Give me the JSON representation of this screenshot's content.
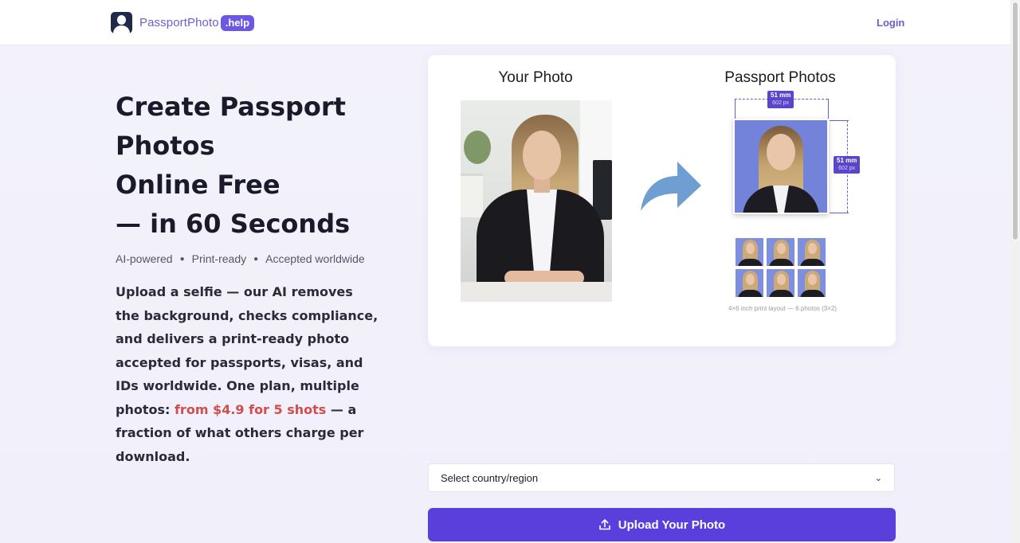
{
  "header": {
    "logo_text": "PassportPhoto",
    "logo_badge": ".help",
    "login_label": "Login"
  },
  "hero": {
    "title_lines": [
      "Create Passport",
      "Photos",
      "Online Free",
      "— in 60 Seconds"
    ],
    "tags": [
      "AI-powered",
      "Print-ready",
      "Accepted worldwide"
    ],
    "description_main": "Upload a selfie — our AI removes the background, checks compliance, and delivers a print-ready photo accepted for passports, visas, and IDs worldwide. One plan, multiple photos: ",
    "description_price": "from $4.9 for 5 shots",
    "description_tail": " — a fraction of what others charge per download."
  },
  "preview": {
    "your_photo_title": "Your Photo",
    "passport_photos_title": "Passport Photos",
    "width_mm": "51 mm",
    "width_px": "602 px",
    "height_mm": "51 mm",
    "height_px": "602 px",
    "layout_caption": "4×6 inch print layout — 6 photos (3×2)"
  },
  "controls": {
    "country_select": "Select country/region",
    "upload_label": "Upload Your Photo"
  },
  "colors": {
    "accent": "#5b3fdc",
    "price_highlight": "#d24d4d",
    "photo_background": "#7383d9"
  },
  "icons": [
    "user-portrait-icon",
    "curved-arrow-icon",
    "upload-icon",
    "chevron-down-icon"
  ]
}
